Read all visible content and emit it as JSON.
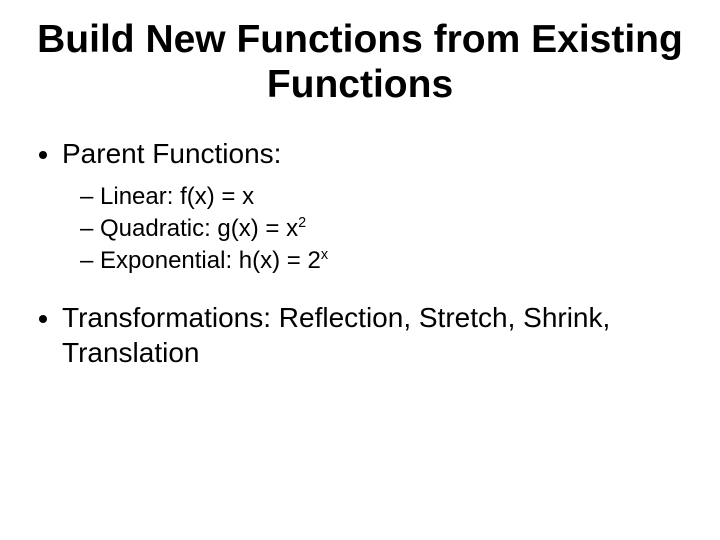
{
  "title": "Build New Functions from Existing Functions",
  "bullets": {
    "parent_label": "Parent Functions:",
    "items": {
      "linear_prefix": "Linear: f(x) = x",
      "quadratic_prefix": "Quadratic: g(x) = x",
      "quadratic_exp": "2",
      "exponential_prefix": "Exponential: h(x) = 2",
      "exponential_exp": "x"
    },
    "transformations": "Transformations: Reflection, Stretch, Shrink, Translation"
  }
}
